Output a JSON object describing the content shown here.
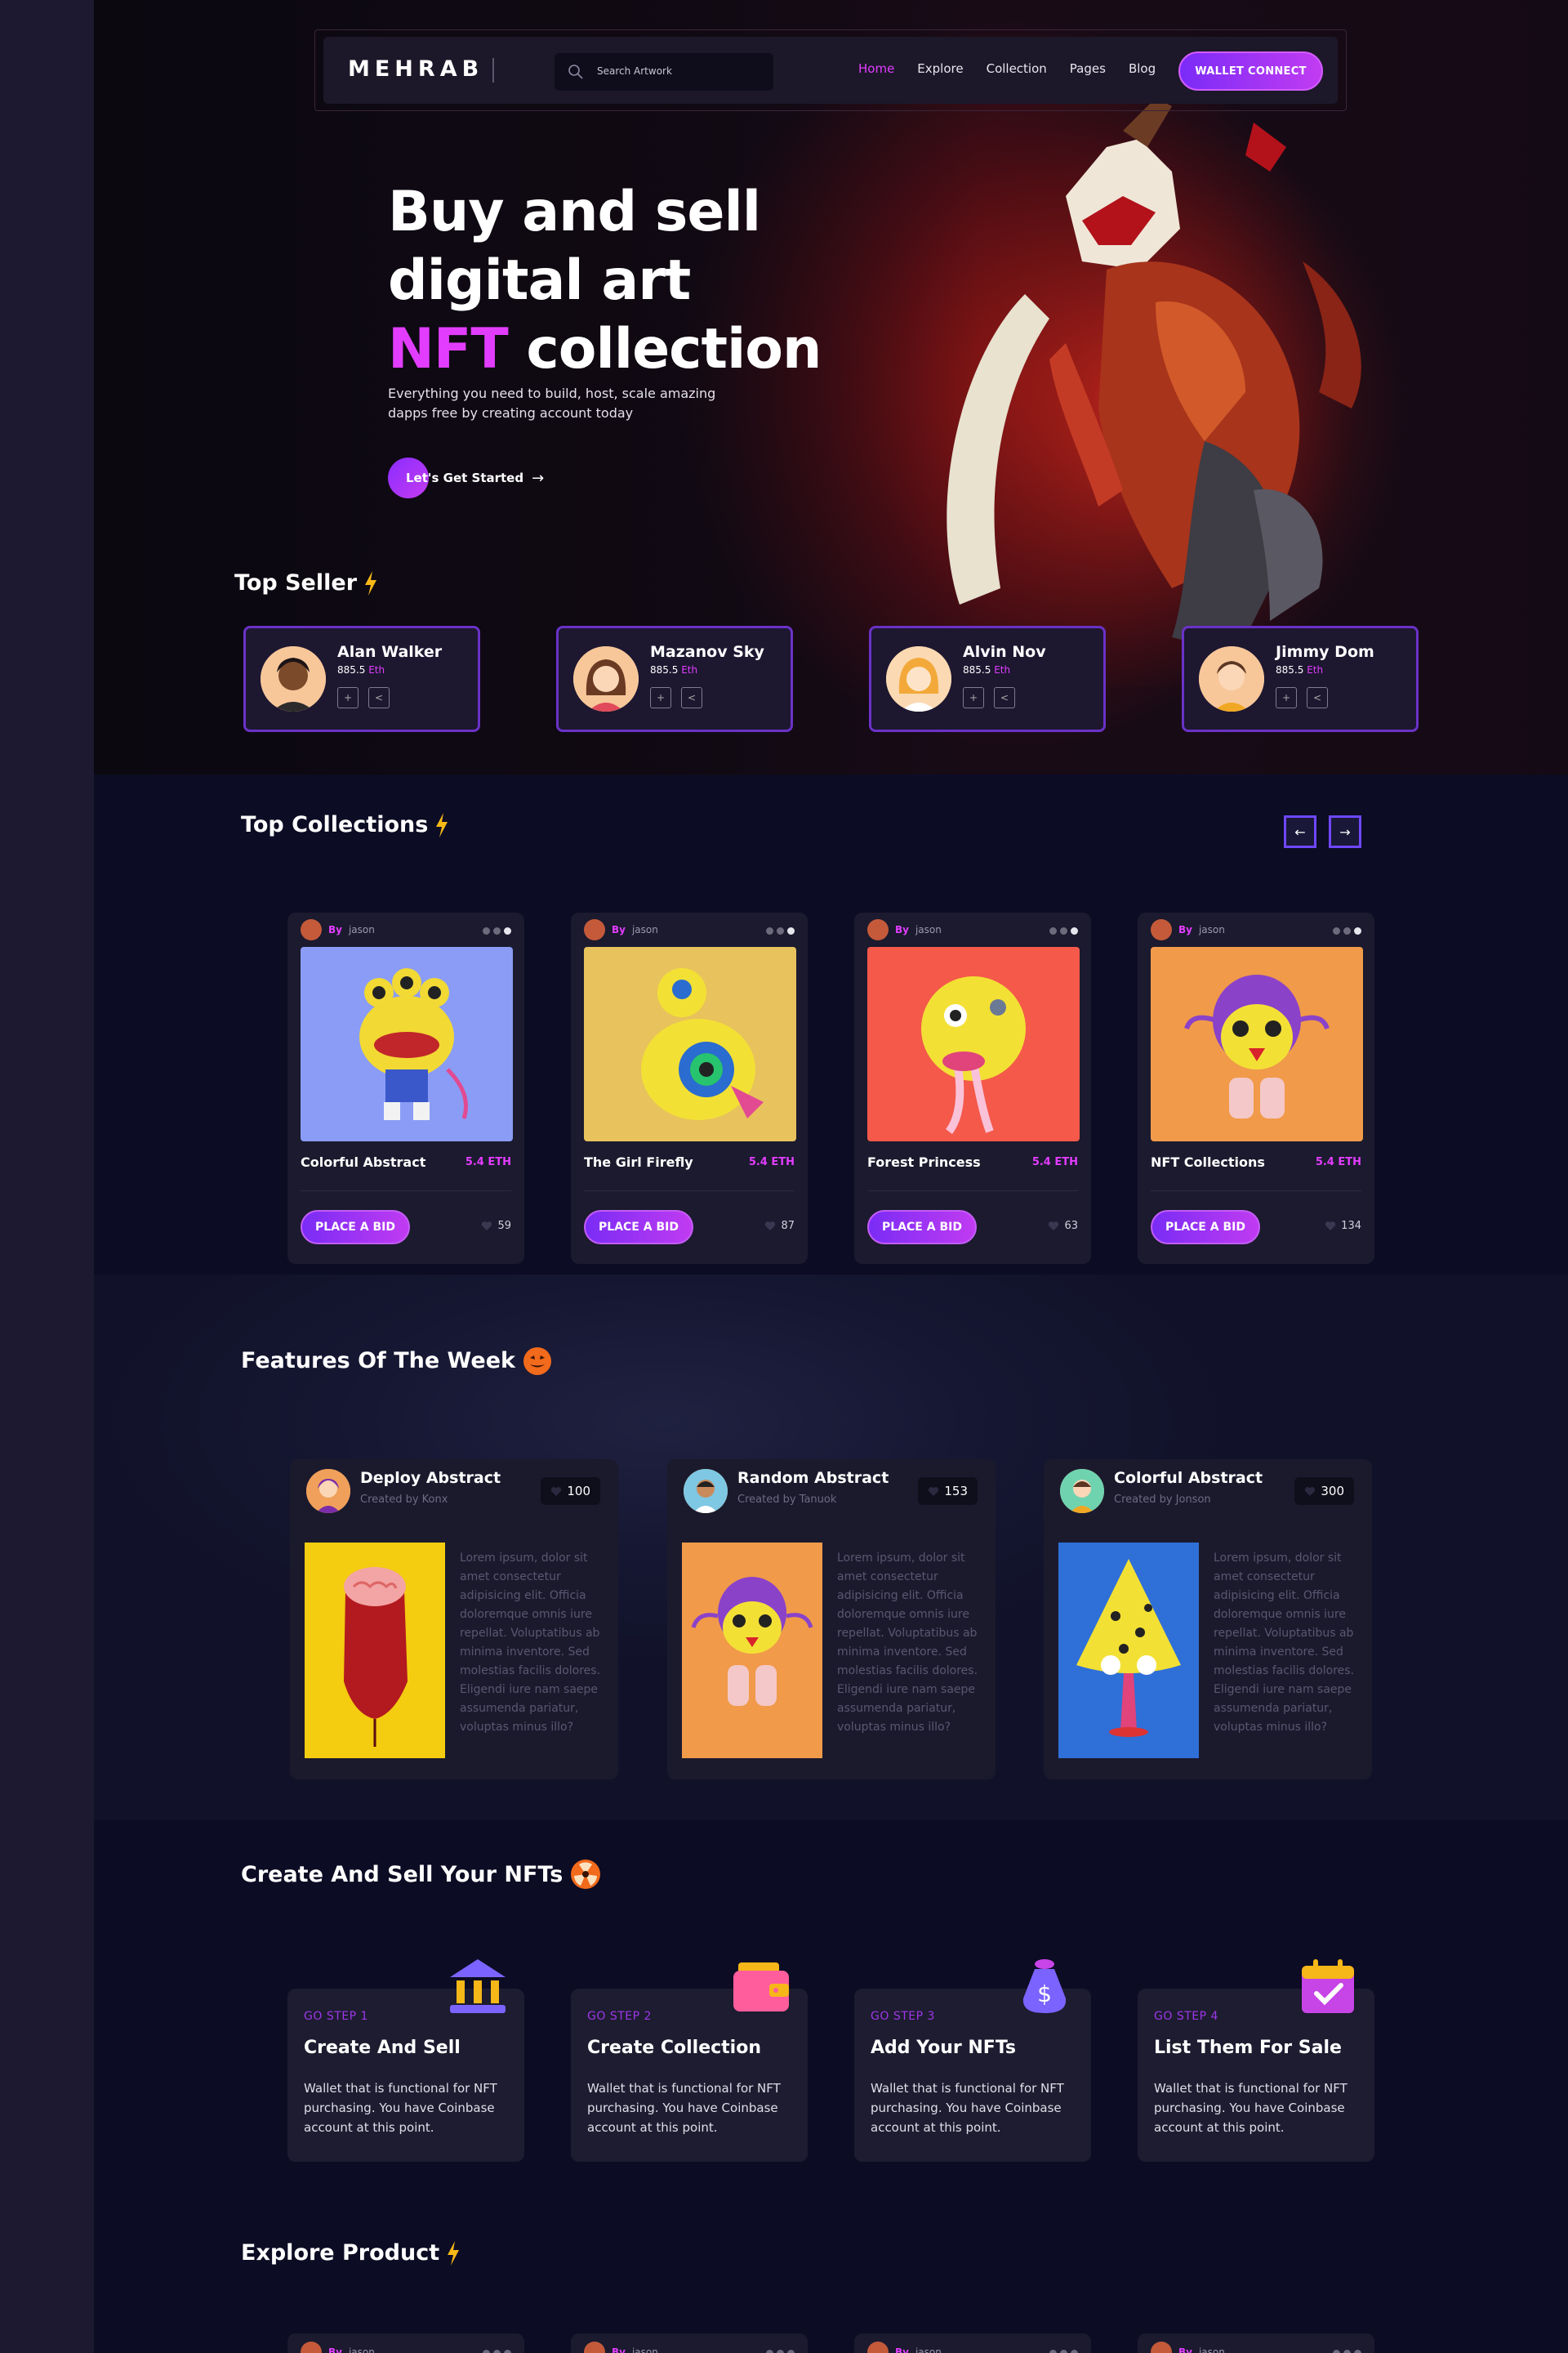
{
  "nav": {
    "logo": "MEHRAB",
    "search_placeholder": "Search Artwork",
    "links": [
      "Home",
      "Explore",
      "Collection",
      "Pages",
      "Blog"
    ],
    "active_link": "Home",
    "wallet_label": "WALLET CONNECT"
  },
  "hero": {
    "title_line1": "Buy and sell",
    "title_line2": "digital art",
    "title_highlight": "NFT",
    "title_line3_rest": " collection",
    "subtitle": "Everything you need to build, host, scale amazing dapps free by creating account today",
    "cta_label": "Let's Get Started",
    "cta_arrow": "→"
  },
  "top_seller": {
    "title": "Top Seller",
    "sellers": [
      {
        "name": "Alan Walker",
        "price": "885.5",
        "unit": "Eth"
      },
      {
        "name": "Mazanov Sky",
        "price": "885.5",
        "unit": "Eth"
      },
      {
        "name": "Alvin Nov",
        "price": "885.5",
        "unit": "Eth"
      },
      {
        "name": "Jimmy Dom",
        "price": "885.5",
        "unit": "Eth"
      }
    ],
    "add_icon": "+",
    "share_icon": "<"
  },
  "top_collections": {
    "title": "Top Collections",
    "prev": "←",
    "next": "→",
    "cards": [
      {
        "by": "By",
        "user": "jason",
        "name": "Colorful Abstract",
        "price": "5.4 ETH",
        "bid": "PLACE A BID",
        "likes": "59",
        "bg": "#8a9cf5"
      },
      {
        "by": "By",
        "user": "jason",
        "name": "The Girl Firefly",
        "price": "5.4 ETH",
        "bid": "PLACE A BID",
        "likes": "87",
        "bg": "#e8c25c"
      },
      {
        "by": "By",
        "user": "jason",
        "name": "Forest Princess",
        "price": "5.4 ETH",
        "bid": "PLACE A BID",
        "likes": "63",
        "bg": "#f4594a"
      },
      {
        "by": "By",
        "user": "jason",
        "name": "NFT Collections",
        "price": "5.4 ETH",
        "bid": "PLACE A BID",
        "likes": "134",
        "bg": "#f09a4a"
      }
    ]
  },
  "features": {
    "title": "Features Of The Week",
    "cards": [
      {
        "name": "Deploy Abstract",
        "creator": "Created by Konx",
        "likes": "100",
        "bg": "#f4cc10",
        "text": "Lorem ipsum, dolor sit amet consectetur adipisicing elit. Officia doloremque omnis iure repellat. Voluptatibus ab minima inventore. Sed molestias facilis dolores. Eligendi iure nam saepe assumenda pariatur, voluptas minus illo?"
      },
      {
        "name": "Random Abstract",
        "creator": "Created by Tanuok",
        "likes": "153",
        "bg": "#f09a4a",
        "text": "Lorem ipsum, dolor sit amet consectetur adipisicing elit. Officia doloremque omnis iure repellat. Voluptatibus ab minima inventore. Sed molestias facilis dolores. Eligendi iure nam saepe assumenda pariatur, voluptas minus illo?"
      },
      {
        "name": "Colorful Abstract",
        "creator": "Created by Jonson",
        "likes": "300",
        "bg": "#2f6fd8",
        "text": "Lorem ipsum, dolor sit amet consectetur adipisicing elit. Officia doloremque omnis iure repellat. Voluptatibus ab minima inventore. Sed molestias facilis dolores. Eligendi iure nam saepe assumenda pariatur, voluptas minus illo?"
      }
    ]
  },
  "steps": {
    "title": "Create And Sell Your NFTs",
    "cards": [
      {
        "step": "GO STEP 1",
        "title": "Create And Sell",
        "desc": "Wallet that is functional for NFT purchasing. You have Coinbase account at this point.",
        "icon": "bank-icon"
      },
      {
        "step": "GO STEP 2",
        "title": "Create Collection",
        "desc": "Wallet that is functional for NFT purchasing. You have Coinbase account at this point.",
        "icon": "wallet-icon"
      },
      {
        "step": "GO STEP 3",
        "title": "Add Your NFTs",
        "desc": "Wallet that is functional for NFT purchasing. You have Coinbase account at this point.",
        "icon": "money-bag-icon"
      },
      {
        "step": "GO STEP 4",
        "title": "List Them For Sale",
        "desc": "Wallet that is functional for NFT purchasing. You have Coinbase account at this point.",
        "icon": "calendar-check-icon"
      }
    ]
  },
  "explore": {
    "title": "Explore Product",
    "cards": [
      {
        "by": "By",
        "user": "jason"
      },
      {
        "by": "By",
        "user": "jason"
      },
      {
        "by": "By",
        "user": "jason"
      },
      {
        "by": "By",
        "user": "jason"
      }
    ]
  },
  "colors": {
    "accent": "#e23dff",
    "button_gradient_start": "#7a2cf5",
    "button_gradient_end": "#c03bf2",
    "bolt": "#f8b916"
  }
}
